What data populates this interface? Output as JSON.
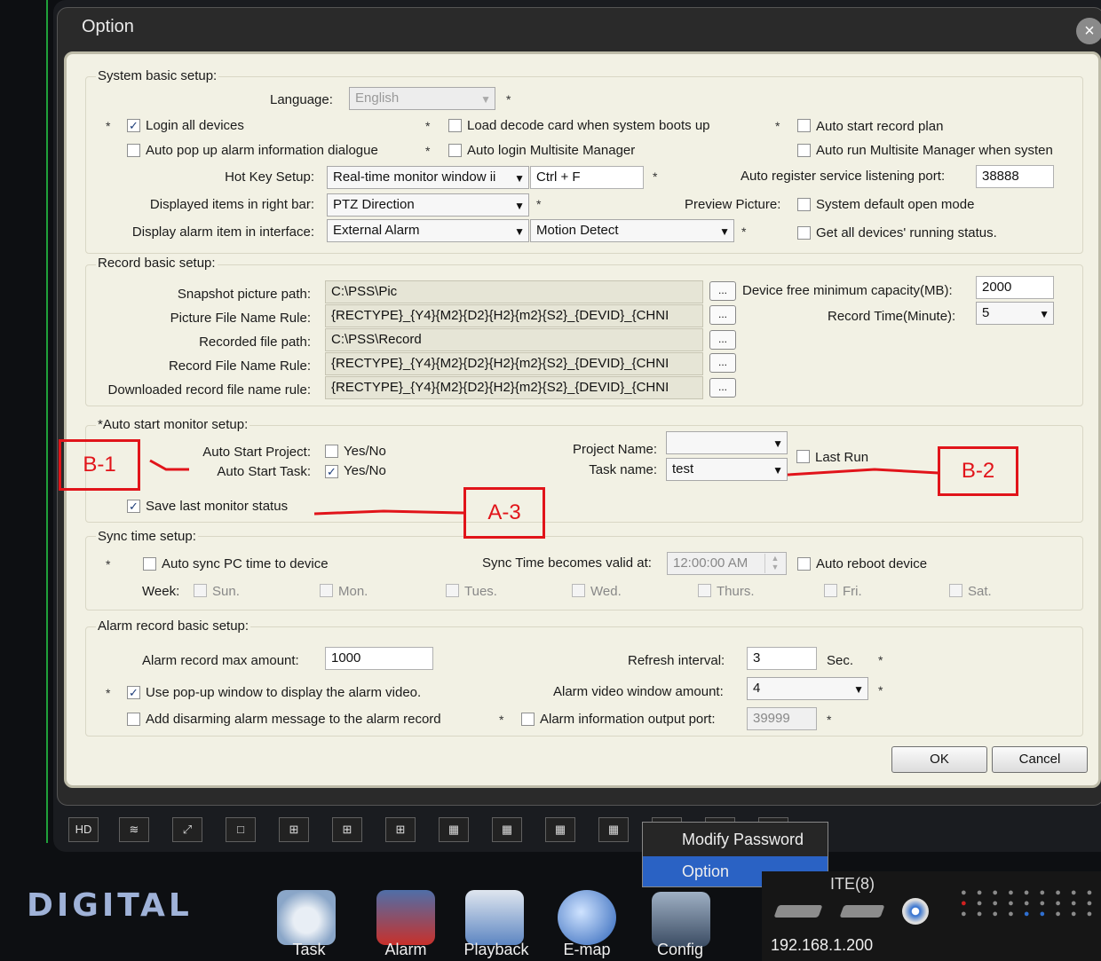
{
  "dialog": {
    "title": "Option",
    "close": "×",
    "ok": "OK",
    "cancel": "Cancel"
  },
  "system": {
    "section": "System basic setup:",
    "language_label": "Language:",
    "language_value": "English",
    "login_all": "Login all devices",
    "load_decode": "Load decode card when system boots up",
    "auto_start_record": "Auto start record plan",
    "auto_popup": "Auto pop up alarm information dialogue",
    "auto_login_multisite": "Auto login Multisite Manager",
    "auto_run_multisite": "Auto run Multisite Manager when systen",
    "hotkey_label": "Hot Key Setup:",
    "hotkey_value": "Real-time monitor window ii",
    "hotkey_keys": "Ctrl + F",
    "auto_register_label": "Auto register service listening port:",
    "auto_register_value": "38888",
    "displayed_items_label": "Displayed items in right bar:",
    "displayed_items_value": "PTZ Direction",
    "preview_label": "Preview Picture:",
    "preview_option": "System default open mode",
    "display_alarm_label": "Display alarm item in interface:",
    "display_alarm_value1": "External Alarm",
    "display_alarm_value2": "Motion Detect",
    "get_all_status": "Get all devices' running status."
  },
  "record": {
    "section": "Record basic setup:",
    "snapshot_label": "Snapshot picture path:",
    "snapshot_value": "C:\\PSS\\Pic",
    "picture_rule_label": "Picture File Name Rule:",
    "picture_rule_value": "{RECTYPE}_{Y4}{M2}{D2}{H2}{m2}{S2}_{DEVID}_{CHNI",
    "recorded_path_label": "Recorded file  path:",
    "recorded_path_value": "C:\\PSS\\Record",
    "record_rule_label": "Record File Name Rule:",
    "record_rule_value": "{RECTYPE}_{Y4}{M2}{D2}{H2}{m2}{S2}_{DEVID}_{CHNI",
    "downloaded_rule_label": "Downloaded record file name rule:",
    "downloaded_rule_value": "{RECTYPE}_{Y4}{M2}{D2}{H2}{m2}{S2}_{DEVID}_{CHNI",
    "browse": "...",
    "device_free_label": "Device free minimum capacity(MB):",
    "device_free_value": "2000",
    "record_time_label": "Record Time(Minute):",
    "record_time_value": "5"
  },
  "automon": {
    "section": "*Auto start monitor setup:",
    "auto_start_project_label": "Auto Start Project:",
    "auto_start_task_label": "Auto Start Task:",
    "yesno": "Yes/No",
    "project_name_label": "Project Name:",
    "project_name_value": "",
    "last_run": "Last Run",
    "task_name_label": "Task name:",
    "task_name_value": "test",
    "save_last": "Save last monitor status"
  },
  "annotations": {
    "b1": "B-1",
    "b2": "B-2",
    "a3": "A-3"
  },
  "sync": {
    "section": "Sync time setup:",
    "auto_sync": "Auto sync PC time to device",
    "valid_at_label": "Sync Time becomes valid at:",
    "valid_at_value": "12:00:00 AM",
    "auto_reboot": "Auto reboot device",
    "week_label": "Week:",
    "days": [
      "Sun.",
      "Mon.",
      "Tues.",
      "Wed.",
      "Thurs.",
      "Fri.",
      "Sat."
    ]
  },
  "alarm": {
    "section": "Alarm record basic setup:",
    "max_amount_label": "Alarm record max amount:",
    "max_amount_value": "1000",
    "refresh_label": "Refresh interval:",
    "refresh_value": "3",
    "refresh_unit": "Sec.",
    "use_popup": "Use pop-up window to display the alarm video.",
    "window_amount_label": "Alarm video window amount:",
    "window_amount_value": "4",
    "add_disarming": "Add disarming alarm message to the alarm record",
    "output_port_label": "Alarm information output port:",
    "output_port_value": "39999"
  },
  "star": "*",
  "toolbar": {
    "hd": "HD"
  },
  "context_menu": {
    "items": [
      "Modify Password",
      "Option"
    ]
  },
  "brand": "DIGITAL",
  "dock": {
    "items": [
      "Task",
      "Alarm",
      "Playback",
      "E-map",
      "Config"
    ]
  },
  "device_panel": {
    "title": "ITE(8)",
    "ip": "192.168.1.200"
  }
}
